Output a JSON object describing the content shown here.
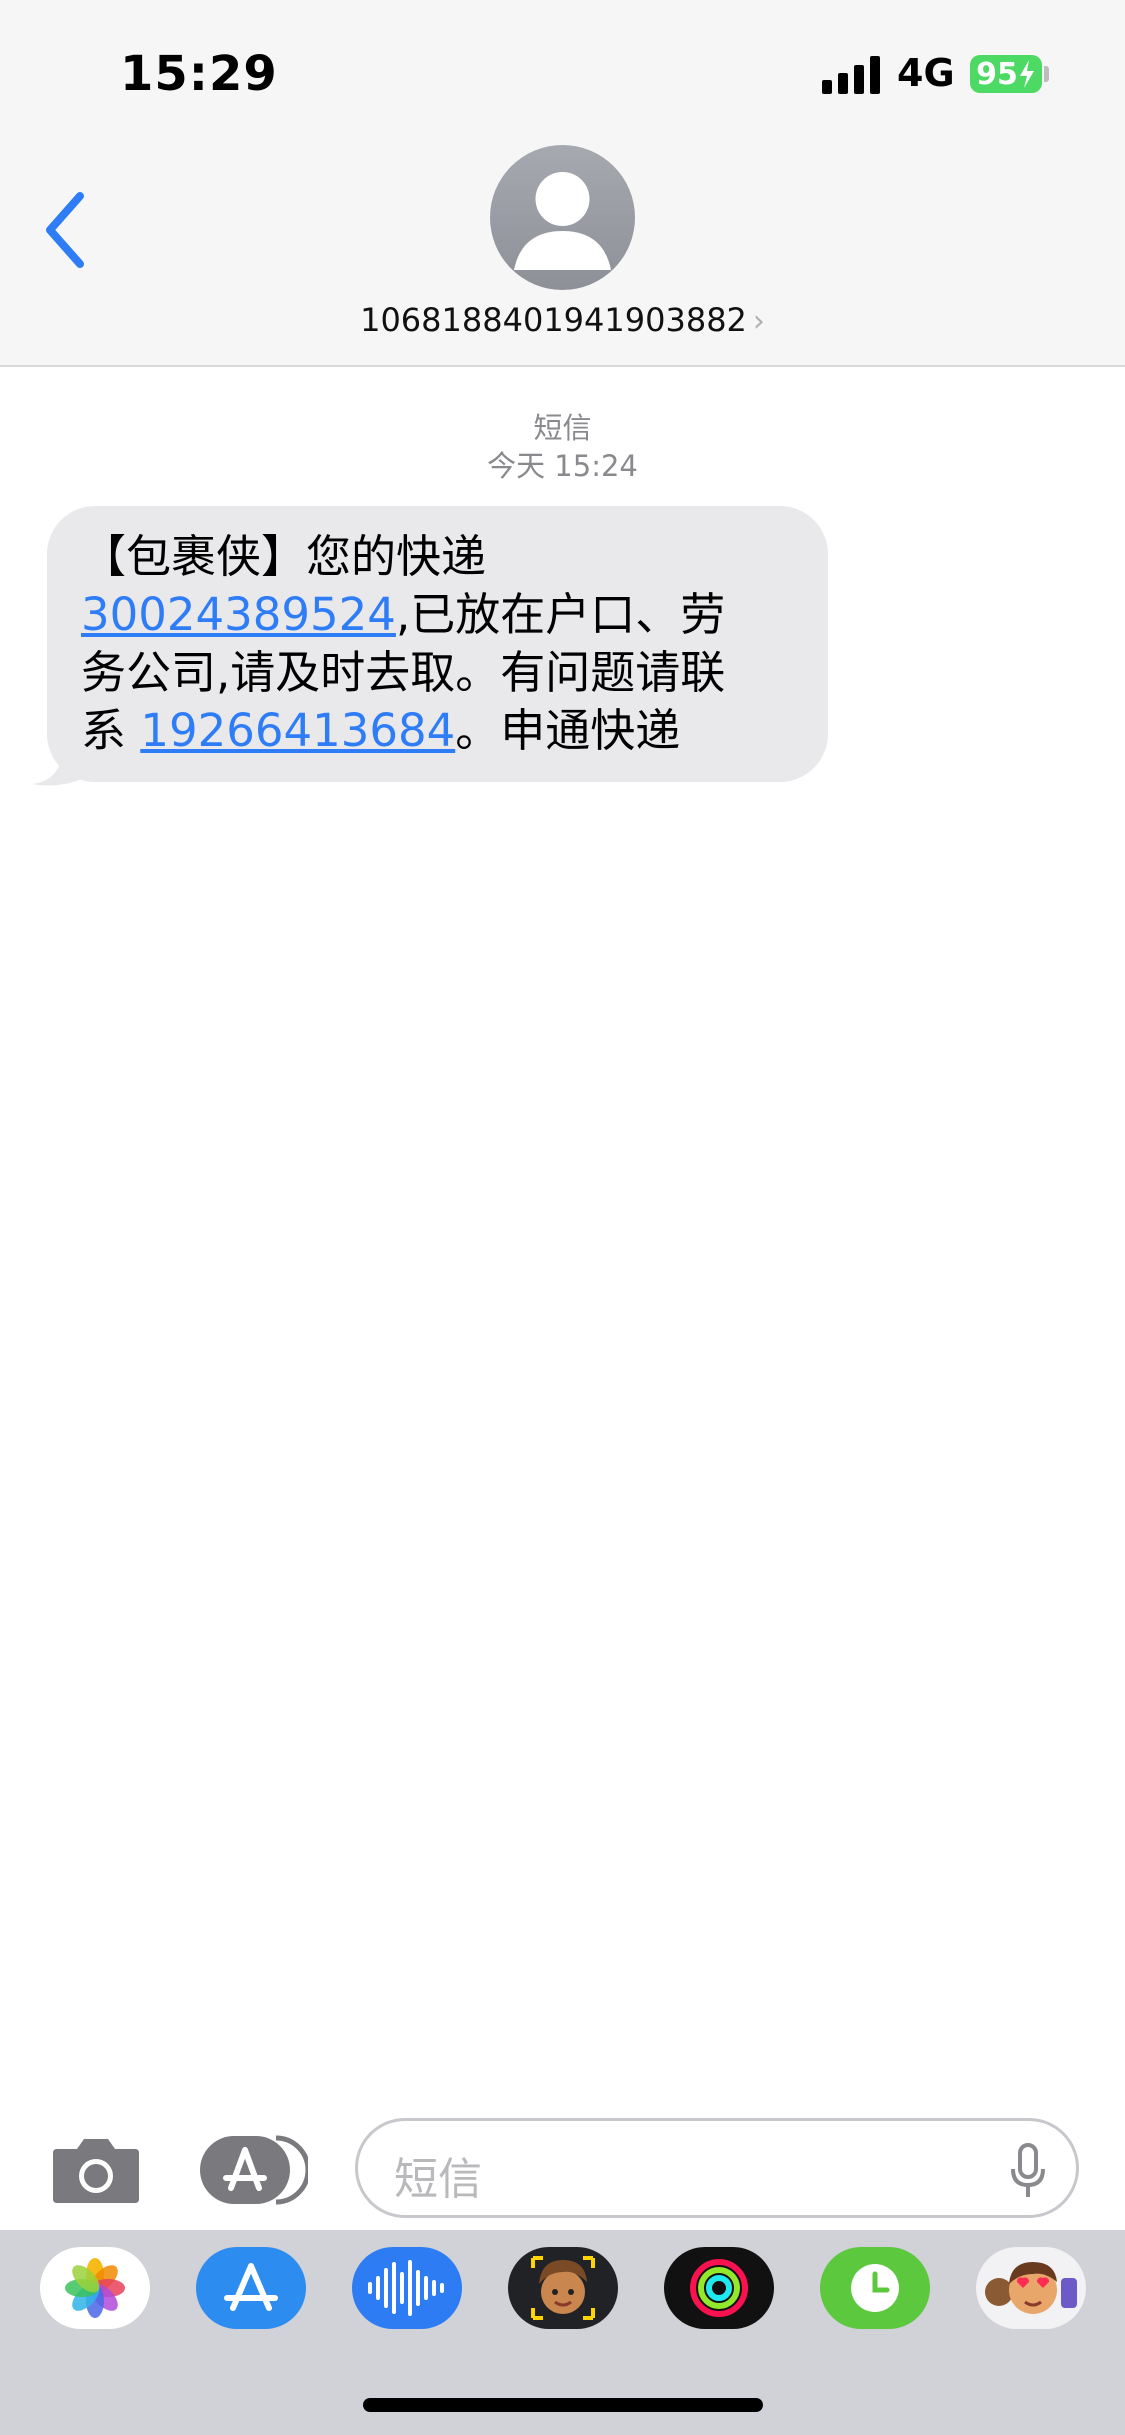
{
  "status": {
    "time": "15:29",
    "network": "4G",
    "battery": "95"
  },
  "header": {
    "contact": "1068188401941903882",
    "chevron": "›"
  },
  "message_meta": {
    "service": "短信",
    "timestamp": "今天 15:24"
  },
  "message": {
    "line1": "【包裹侠】您的快递",
    "tracking_number": "30024389524",
    "line2_rest": ",已放在户口、劳",
    "line3": "务公司,请及时去取。有问题请联",
    "line4_pre": "系 ",
    "phone": "19266413684",
    "line4_post": "。申通快递"
  },
  "composer": {
    "placeholder": "短信"
  },
  "tray": {
    "apps": [
      "photos-icon",
      "app-store-icon",
      "audio-message-icon",
      "memoji-icon",
      "activity-icon",
      "clock-icon",
      "animoji-icon"
    ]
  },
  "colors": {
    "link": "#2f7df6",
    "back_chevron": "#2f7df6",
    "bubble": "#e9e9eb",
    "battery": "#4cd964"
  }
}
